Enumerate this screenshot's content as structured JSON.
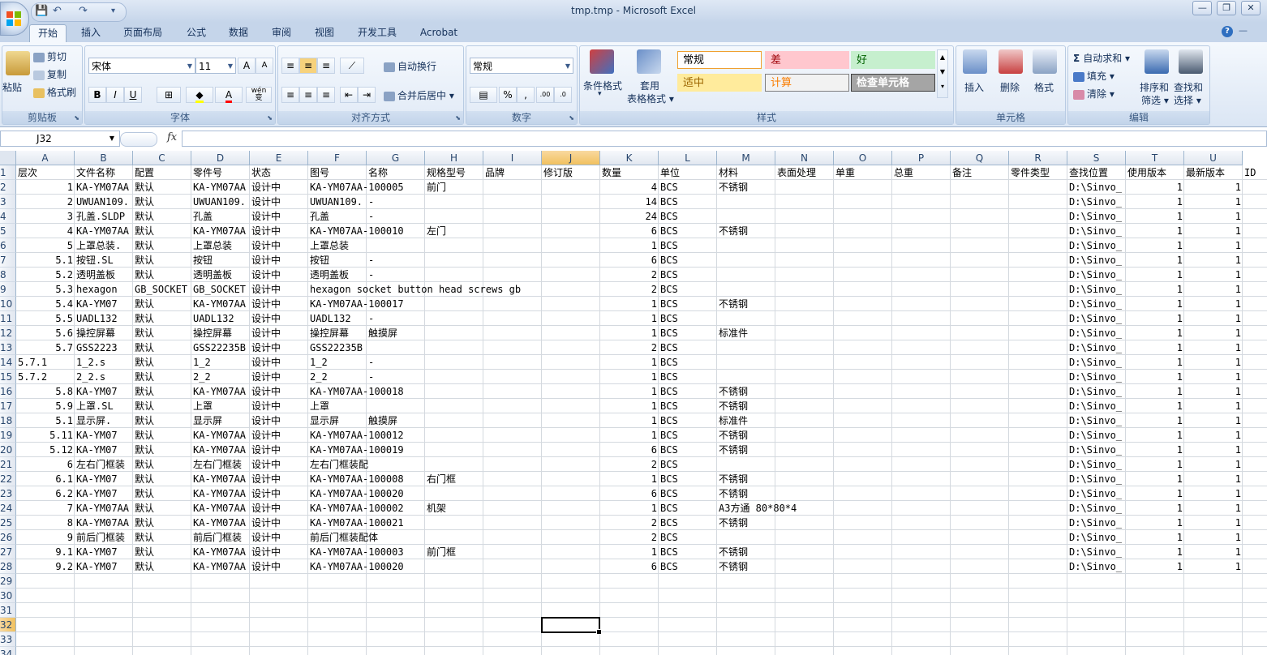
{
  "window": {
    "title": "tmp.tmp - Microsoft Excel",
    "controls": {
      "minimize": "—",
      "restore": "❐",
      "close": "✕"
    }
  },
  "quick_access": {
    "save": "💾",
    "undo": "↶",
    "redo": "↷",
    "customize": "▾"
  },
  "tabs": [
    "开始",
    "插入",
    "页面布局",
    "公式",
    "数据",
    "审阅",
    "视图",
    "开发工具",
    "Acrobat"
  ],
  "active_tab": "开始",
  "ribbon": {
    "clipboard": {
      "label": "剪贴板",
      "paste": "粘贴",
      "cut": "剪切",
      "copy": "复制",
      "format_painter": "格式刷"
    },
    "font": {
      "label": "字体",
      "font_name": "宋体",
      "font_size": "11",
      "grow": "A",
      "shrink": "A",
      "bold": "B",
      "italic": "I",
      "underline": "U",
      "wen": "wén",
      "wen_char": "变"
    },
    "alignment": {
      "label": "对齐方式",
      "wrap": "自动换行",
      "merge": "合并后居中"
    },
    "number": {
      "label": "数字",
      "format": "常规",
      "percent": "%",
      "comma": ",",
      "inc_dec": ".00",
      "dec_dec": ".0"
    },
    "styles": {
      "label": "样式",
      "conditional": "条件格式",
      "table_1": "套用",
      "table_2": "表格格式",
      "cells": [
        {
          "text": "常规",
          "bg": "#ffffff",
          "color": "#000000",
          "border": "#f0a030"
        },
        {
          "text": "差",
          "bg": "#ffc7ce",
          "color": "#9c0006",
          "border": "#ffc7ce"
        },
        {
          "text": "好",
          "bg": "#c6efce",
          "color": "#006100",
          "border": "#c6efce"
        },
        {
          "text": "适中",
          "bg": "#ffeb9c",
          "color": "#9c6500",
          "border": "#ffeb9c"
        },
        {
          "text": "计算",
          "bg": "#f2f2f2",
          "color": "#fa7d00",
          "border": "#7f7f7f"
        },
        {
          "text": "检查单元格",
          "bg": "#a5a5a5",
          "color": "#ffffff",
          "border": "#3f3f3f"
        }
      ]
    },
    "cells_group": {
      "label": "单元格",
      "insert": "插入",
      "delete": "删除",
      "format": "格式"
    },
    "editing": {
      "label": "编辑",
      "autosum": "自动求和",
      "fill": "填充",
      "clear": "清除",
      "sort_1": "排序和",
      "sort_2": "筛选",
      "find_1": "查找和",
      "find_2": "选择"
    }
  },
  "name_box": "J32",
  "fx_label": "fx",
  "columns": [
    "A",
    "B",
    "C",
    "D",
    "E",
    "F",
    "G",
    "H",
    "I",
    "J",
    "K",
    "L",
    "M",
    "N",
    "O",
    "P",
    "Q",
    "R",
    "S",
    "T",
    "U"
  ],
  "selected_column": "J",
  "selected_row": 32,
  "row_numbers": [
    "1",
    "2",
    "3",
    "4",
    "5",
    "6",
    "7",
    "8",
    "9",
    "10",
    "11",
    "12",
    "13",
    "14",
    "15",
    "16",
    "17",
    "18",
    "19",
    "20",
    "21",
    "22",
    "23",
    "24",
    "25",
    "26",
    "27",
    "28",
    "29",
    "30",
    "31",
    "32",
    "33",
    "34"
  ],
  "header_row": [
    "层次",
    "文件名称",
    "配置",
    "零件号",
    "状态",
    "图号",
    "名称",
    "规格型号",
    "品牌",
    "修订版",
    "数量",
    "单位",
    "材料",
    "表面处理",
    "单重",
    "总重",
    "备注",
    "零件类型",
    "查找位置",
    "使用版本",
    "最新版本",
    "ID"
  ],
  "rows": [
    {
      "A": "1",
      "B": "KA-YM07AA",
      "C": "默认",
      "D": "KA-YM07AA",
      "E": "设计中",
      "F": "KA-YM07AA-100005",
      "H": "前门",
      "K": "4",
      "L": "BCS",
      "M": "不锈钢",
      "S": "D:\\Sinvo_",
      "T": "1",
      "U": "1"
    },
    {
      "A": "2",
      "B": "UWUAN109.",
      "C": "默认",
      "D": "UWUAN109.",
      "E": "设计中",
      "F": "UWUAN109.",
      "G": "-",
      "K": "14",
      "L": "BCS",
      "S": "D:\\Sinvo_",
      "T": "1",
      "U": "1"
    },
    {
      "A": "3",
      "B": "孔盖.SLDP",
      "C": "默认",
      "D": "孔盖",
      "E": "设计中",
      "F": "孔盖",
      "G": "-",
      "K": "24",
      "L": "BCS",
      "S": "D:\\Sinvo_",
      "T": "1",
      "U": "1"
    },
    {
      "A": "4",
      "B": "KA-YM07AA",
      "C": "默认",
      "D": "KA-YM07AA",
      "E": "设计中",
      "F": "KA-YM07AA-100010",
      "H": "左门",
      "K": "6",
      "L": "BCS",
      "M": "不锈钢",
      "S": "D:\\Sinvo_",
      "T": "1",
      "U": "1"
    },
    {
      "A": "5",
      "B": "上罩总装.",
      "C": "默认",
      "D": "上罩总装",
      "E": "设计中",
      "F": "上罩总装",
      "K": "1",
      "L": "BCS",
      "S": "D:\\Sinvo_",
      "T": "1",
      "U": "1"
    },
    {
      "A": "5.1",
      "B": "按钮.SL",
      "C": "默认",
      "D": "按钮",
      "E": "设计中",
      "F": "按钮",
      "G": "-",
      "K": "6",
      "L": "BCS",
      "S": "D:\\Sinvo_",
      "T": "1",
      "U": "1"
    },
    {
      "A": "5.2",
      "B": "透明盖板",
      "C": "默认",
      "D": "透明盖板",
      "E": "设计中",
      "F": "透明盖板",
      "G": "-",
      "K": "2",
      "L": "BCS",
      "S": "D:\\Sinvo_",
      "T": "1",
      "U": "1"
    },
    {
      "A": "5.3",
      "B": "hexagon",
      "C": "GB_SOCKET",
      "D": "GB_SOCKET",
      "E": "设计中",
      "F": "hexagon socket button head screws gb",
      "K": "2",
      "L": "BCS",
      "S": "D:\\Sinvo_",
      "T": "1",
      "U": "1"
    },
    {
      "A": "5.4",
      "B": "KA-YM07",
      "C": "默认",
      "D": "KA-YM07AA",
      "E": "设计中",
      "F": "KA-YM07AA-100017",
      "K": "1",
      "L": "BCS",
      "M": "不锈钢",
      "S": "D:\\Sinvo_",
      "T": "1",
      "U": "1"
    },
    {
      "A": "5.5",
      "B": "UADL132",
      "C": "默认",
      "D": "UADL132",
      "E": "设计中",
      "F": "UADL132",
      "G": "-",
      "K": "1",
      "L": "BCS",
      "S": "D:\\Sinvo_",
      "T": "1",
      "U": "1"
    },
    {
      "A": "5.6",
      "B": "操控屏幕",
      "C": "默认",
      "D": "操控屏幕",
      "E": "设计中",
      "F": "操控屏幕",
      "G": "触摸屏",
      "K": "1",
      "L": "BCS",
      "M": "标准件",
      "S": "D:\\Sinvo_",
      "T": "1",
      "U": "1"
    },
    {
      "A": "5.7",
      "B": "GSS2223",
      "C": "默认",
      "D": "GSS22235B",
      "E": "设计中",
      "F": "GSS22235B",
      "K": "2",
      "L": "BCS",
      "S": "D:\\Sinvo_",
      "T": "1",
      "U": "1"
    },
    {
      "A": "5.7.1",
      "Aleft": true,
      "B": "1_2.s",
      "C": "默认",
      "D": "1_2",
      "E": "设计中",
      "F": "1_2",
      "G": "-",
      "K": "1",
      "L": "BCS",
      "S": "D:\\Sinvo_",
      "T": "1",
      "U": "1"
    },
    {
      "A": "5.7.2",
      "Aleft": true,
      "B": "2_2.s",
      "C": "默认",
      "D": "2_2",
      "E": "设计中",
      "F": "2_2",
      "G": "-",
      "K": "1",
      "L": "BCS",
      "S": "D:\\Sinvo_",
      "T": "1",
      "U": "1"
    },
    {
      "A": "5.8",
      "B": "KA-YM07",
      "C": "默认",
      "D": "KA-YM07AA",
      "E": "设计中",
      "F": "KA-YM07AA-100018",
      "K": "1",
      "L": "BCS",
      "M": "不锈钢",
      "S": "D:\\Sinvo_",
      "T": "1",
      "U": "1"
    },
    {
      "A": "5.9",
      "B": "上罩.SL",
      "C": "默认",
      "D": "上罩",
      "E": "设计中",
      "F": "上罩",
      "K": "1",
      "L": "BCS",
      "M": "不锈钢",
      "S": "D:\\Sinvo_",
      "T": "1",
      "U": "1"
    },
    {
      "A": "5.1",
      "B": "显示屏.",
      "C": "默认",
      "D": "显示屏",
      "E": "设计中",
      "F": "显示屏",
      "G": "触摸屏",
      "K": "1",
      "L": "BCS",
      "M": "标准件",
      "S": "D:\\Sinvo_",
      "T": "1",
      "U": "1"
    },
    {
      "A": "5.11",
      "B": "KA-YM07",
      "C": "默认",
      "D": "KA-YM07AA",
      "E": "设计中",
      "F": "KA-YM07AA-100012",
      "K": "1",
      "L": "BCS",
      "M": "不锈钢",
      "S": "D:\\Sinvo_",
      "T": "1",
      "U": "1"
    },
    {
      "A": "5.12",
      "B": "KA-YM07",
      "C": "默认",
      "D": "KA-YM07AA",
      "E": "设计中",
      "F": "KA-YM07AA-100019",
      "K": "6",
      "L": "BCS",
      "M": "不锈钢",
      "S": "D:\\Sinvo_",
      "T": "1",
      "U": "1"
    },
    {
      "A": "6",
      "B": "左右门框装",
      "C": "默认",
      "D": "左右门框装",
      "E": "设计中",
      "F": "左右门框装配",
      "K": "2",
      "L": "BCS",
      "S": "D:\\Sinvo_",
      "T": "1",
      "U": "1"
    },
    {
      "A": "6.1",
      "B": "KA-YM07",
      "C": "默认",
      "D": "KA-YM07AA",
      "E": "设计中",
      "F": "KA-YM07AA-100008",
      "H": "右门框",
      "K": "1",
      "L": "BCS",
      "M": "不锈钢",
      "S": "D:\\Sinvo_",
      "T": "1",
      "U": "1"
    },
    {
      "A": "6.2",
      "B": "KA-YM07",
      "C": "默认",
      "D": "KA-YM07AA",
      "E": "设计中",
      "F": "KA-YM07AA-100020",
      "K": "6",
      "L": "BCS",
      "M": "不锈钢",
      "S": "D:\\Sinvo_",
      "T": "1",
      "U": "1"
    },
    {
      "A": "7",
      "B": "KA-YM07AA",
      "C": "默认",
      "D": "KA-YM07AA",
      "E": "设计中",
      "F": "KA-YM07AA-100002",
      "H": "机架",
      "K": "1",
      "L": "BCS",
      "M": "A3方通 80*80*4",
      "S": "D:\\Sinvo_",
      "T": "1",
      "U": "1"
    },
    {
      "A": "8",
      "B": "KA-YM07AA",
      "C": "默认",
      "D": "KA-YM07AA",
      "E": "设计中",
      "F": "KA-YM07AA-100021",
      "K": "2",
      "L": "BCS",
      "M": "不锈钢",
      "S": "D:\\Sinvo_",
      "T": "1",
      "U": "1"
    },
    {
      "A": "9",
      "B": "前后门框装",
      "C": "默认",
      "D": "前后门框装",
      "E": "设计中",
      "F": "前后门框装配体",
      "K": "2",
      "L": "BCS",
      "S": "D:\\Sinvo_",
      "T": "1",
      "U": "1"
    },
    {
      "A": "9.1",
      "B": "KA-YM07",
      "C": "默认",
      "D": "KA-YM07AA",
      "E": "设计中",
      "F": "KA-YM07AA-100003",
      "H": "前门框",
      "K": "1",
      "L": "BCS",
      "M": "不锈钢",
      "S": "D:\\Sinvo_",
      "T": "1",
      "U": "1"
    },
    {
      "A": "9.2",
      "B": "KA-YM07",
      "C": "默认",
      "D": "KA-YM07AA",
      "E": "设计中",
      "F": "KA-YM07AA-100020",
      "K": "6",
      "L": "BCS",
      "M": "不锈钢",
      "S": "D:\\Sinvo_",
      "T": "1",
      "U": "1"
    }
  ]
}
